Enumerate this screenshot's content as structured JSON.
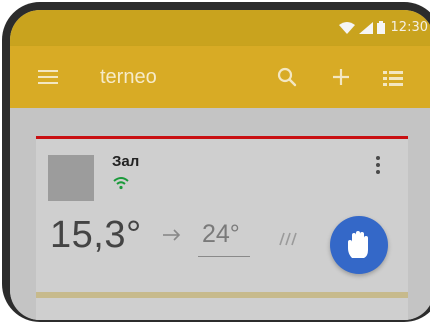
{
  "status_bar": {
    "time": "12:30",
    "icons": [
      "wifi-icon",
      "signal-icon",
      "battery-icon"
    ]
  },
  "app_bar": {
    "title": "terneo",
    "icons": [
      "menu-icon",
      "search-icon",
      "add-icon",
      "list-icon"
    ],
    "color": "#d8ab25"
  },
  "zone_card": {
    "name": "Зал",
    "current_temperature": "15,3°",
    "target_temperature": "24°",
    "accent_color": "#c90f12",
    "mode_button_icon": "hand-icon",
    "mode_button_color": "#3468c8"
  }
}
